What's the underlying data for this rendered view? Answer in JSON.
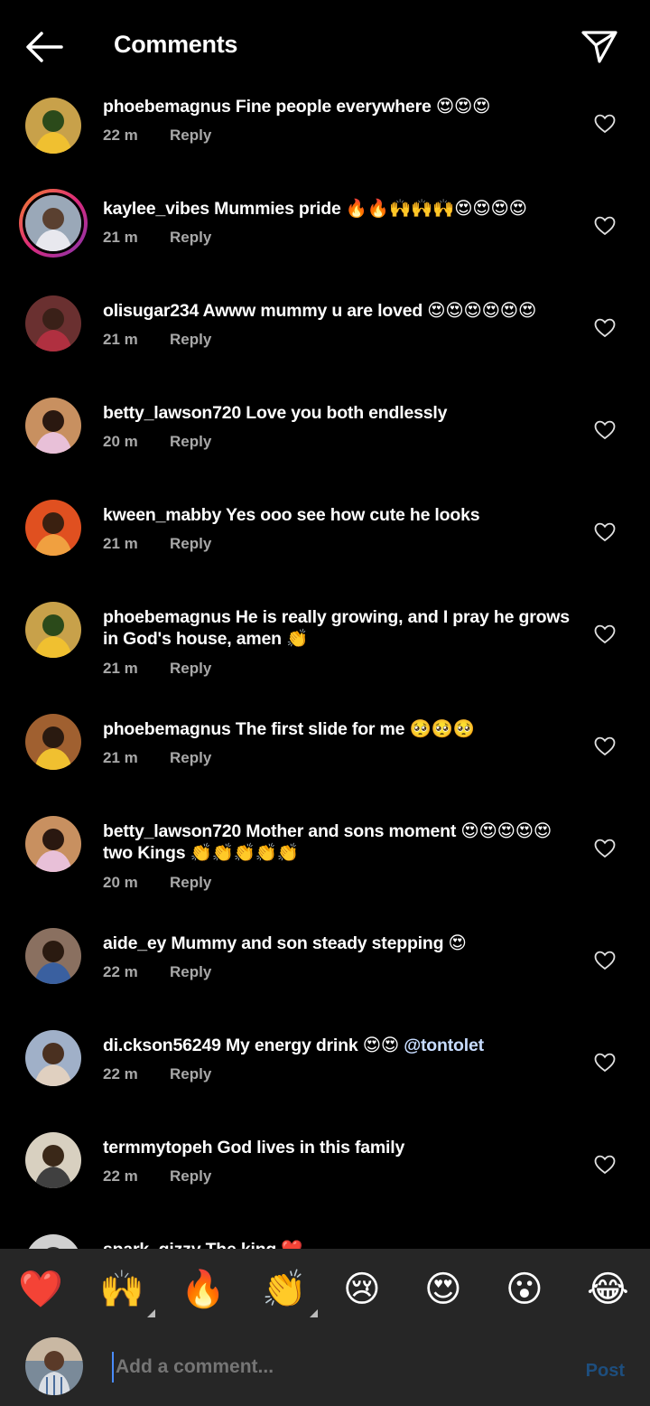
{
  "header": {
    "title": "Comments",
    "back_icon": "arrow-left-icon",
    "send_icon": "paper-plane-icon"
  },
  "comments": [
    {
      "user": "phoebemagnus",
      "text": " Fine people everywhere 😍😍😍",
      "time": "22 m",
      "reply": "Reply"
    },
    {
      "user": "kaylee_vibes",
      "text": " Mummies pride 🔥🔥🙌🙌🙌😍😍😍😍",
      "time": "21 m",
      "reply": "Reply"
    },
    {
      "user": "olisugar234",
      "text": " Awww mummy u are loved 😍😍😍😍😍😍",
      "time": "21 m",
      "reply": "Reply"
    },
    {
      "user": "betty_lawson720",
      "text": " Love you both endlessly",
      "time": "20 m",
      "reply": "Reply"
    },
    {
      "user": "kween_mabby",
      "text": " Yes ooo see how cute he looks",
      "time": "21 m",
      "reply": "Reply"
    },
    {
      "user": "phoebemagnus",
      "text": " He is really growing, and I pray he grows in God's house, amen 👏",
      "time": "21 m",
      "reply": "Reply"
    },
    {
      "user": "phoebemagnus",
      "text": " The first slide for me 🥺🥺🥺",
      "time": "21 m",
      "reply": "Reply"
    },
    {
      "user": "betty_lawson720",
      "text": " Mother and sons moment 😍😍😍😍😍 two Kings 👏👏👏👏👏",
      "time": "20 m",
      "reply": "Reply"
    },
    {
      "user": "aide_ey",
      "text": " Mummy and son steady stepping 😍",
      "time": "22 m",
      "reply": "Reply"
    },
    {
      "user": "di.ckson56249",
      "text": " My energy drink 😍😍 ",
      "mention": "@tontolet",
      "time": "22 m",
      "reply": "Reply"
    },
    {
      "user": "termmytopeh",
      "text": " God lives in this family",
      "time": "22 m",
      "reply": "Reply"
    },
    {
      "user": "spark_gizzy",
      "text": " The king ❤️",
      "time": "",
      "reply": ""
    }
  ],
  "emoji_bar": [
    "❤️",
    "🙌",
    "🔥",
    "👏",
    "😢",
    "😍",
    "😮",
    "😂"
  ],
  "compose": {
    "placeholder": "Add a comment...",
    "post_label": "Post"
  },
  "colors": {
    "background": "#000000",
    "bar": "#262626",
    "muted_text": "#a8a8a8",
    "post_disabled": "#1d4e7e",
    "story_ring": "#dd2a7b"
  }
}
